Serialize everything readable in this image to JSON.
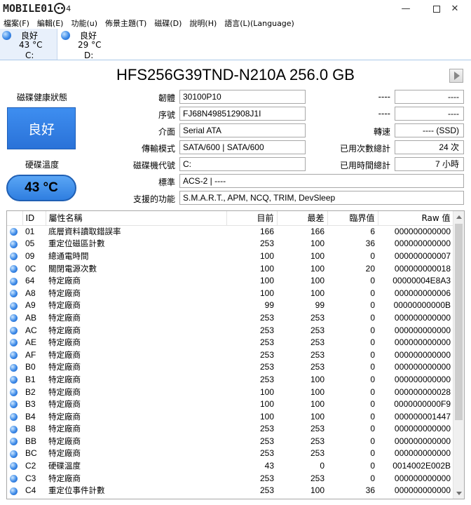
{
  "window": {
    "logo_text": "MOBILE01",
    "logo_version": "4",
    "minimize_label": "—",
    "close_label": "✕"
  },
  "menu": [
    {
      "label": "檔案(F)"
    },
    {
      "label": "編輯(E)"
    },
    {
      "label": "功能(u)"
    },
    {
      "label": "佈景主題(T)"
    },
    {
      "label": "磁碟(D)"
    },
    {
      "label": "說明(H)"
    },
    {
      "label": "語言(L)(Language)"
    }
  ],
  "drives": [
    {
      "status": "良好",
      "temp": "43 °C",
      "letter": "C:",
      "status_color": "#3c8ae8"
    },
    {
      "status": "良好",
      "temp": "29 °C",
      "letter": "D:",
      "status_color": "#3c8ae8"
    }
  ],
  "disk": {
    "title": "HFS256G39TND-N210A 256.0 GB",
    "health_label": "磁碟健康狀態",
    "health_value": "良好",
    "temp_label": "硬碟溫度",
    "temp_value": "43 °C"
  },
  "info_left": {
    "firmware_label": "韌體",
    "firmware": "30100P10",
    "serial_label": "序號",
    "serial": "FJ68N498512908J1I",
    "interface_label": "介面",
    "interface": "Serial ATA",
    "transfer_label": "傳輸模式",
    "transfer": "SATA/600 | SATA/600",
    "drive_letter_label": "磁碟機代號",
    "drive_letter": "C:",
    "standard_label": "標準",
    "standard": "ACS-2 | ----",
    "features_label": "支援的功能",
    "features": "S.M.A.R.T., APM, NCQ, TRIM, DevSleep"
  },
  "info_right": {
    "blank1_label": "----",
    "blank1": "----",
    "blank2_label": "----",
    "blank2": "----",
    "rotation_label": "轉速",
    "rotation": "---- (SSD)",
    "power_count_label": "已用次數總計",
    "power_count": "24 次",
    "power_hours_label": "已用時間總計",
    "power_hours": "7 小時"
  },
  "table": {
    "headers": [
      "",
      "ID",
      "屬性名稱",
      "目前",
      "最差",
      "臨界值",
      "Raw 值"
    ],
    "rows": [
      {
        "id": "01",
        "name": "底層資料讀取錯誤率",
        "current": "166",
        "worst": "166",
        "threshold": "6",
        "raw": "000000000000"
      },
      {
        "id": "05",
        "name": "重定位磁區計數",
        "current": "253",
        "worst": "100",
        "threshold": "36",
        "raw": "000000000000"
      },
      {
        "id": "09",
        "name": "總通電時間",
        "current": "100",
        "worst": "100",
        "threshold": "0",
        "raw": "000000000007"
      },
      {
        "id": "0C",
        "name": "關閉電源次數",
        "current": "100",
        "worst": "100",
        "threshold": "20",
        "raw": "000000000018"
      },
      {
        "id": "64",
        "name": "特定廠商",
        "current": "100",
        "worst": "100",
        "threshold": "0",
        "raw": "00000004E8A3"
      },
      {
        "id": "A8",
        "name": "特定廠商",
        "current": "100",
        "worst": "100",
        "threshold": "0",
        "raw": "000000000006"
      },
      {
        "id": "A9",
        "name": "特定廠商",
        "current": "99",
        "worst": "99",
        "threshold": "0",
        "raw": "00000000000B"
      },
      {
        "id": "AB",
        "name": "特定廠商",
        "current": "253",
        "worst": "253",
        "threshold": "0",
        "raw": "000000000000"
      },
      {
        "id": "AC",
        "name": "特定廠商",
        "current": "253",
        "worst": "253",
        "threshold": "0",
        "raw": "000000000000"
      },
      {
        "id": "AE",
        "name": "特定廠商",
        "current": "253",
        "worst": "253",
        "threshold": "0",
        "raw": "000000000000"
      },
      {
        "id": "AF",
        "name": "特定廠商",
        "current": "253",
        "worst": "253",
        "threshold": "0",
        "raw": "000000000000"
      },
      {
        "id": "B0",
        "name": "特定廠商",
        "current": "253",
        "worst": "253",
        "threshold": "0",
        "raw": "000000000000"
      },
      {
        "id": "B1",
        "name": "特定廠商",
        "current": "253",
        "worst": "100",
        "threshold": "0",
        "raw": "000000000000"
      },
      {
        "id": "B2",
        "name": "特定廠商",
        "current": "100",
        "worst": "100",
        "threshold": "0",
        "raw": "000000000028"
      },
      {
        "id": "B3",
        "name": "特定廠商",
        "current": "100",
        "worst": "100",
        "threshold": "0",
        "raw": "0000000000F9"
      },
      {
        "id": "B4",
        "name": "特定廠商",
        "current": "100",
        "worst": "100",
        "threshold": "0",
        "raw": "000000001447"
      },
      {
        "id": "B8",
        "name": "特定廠商",
        "current": "253",
        "worst": "253",
        "threshold": "0",
        "raw": "000000000000"
      },
      {
        "id": "BB",
        "name": "特定廠商",
        "current": "253",
        "worst": "253",
        "threshold": "0",
        "raw": "000000000000"
      },
      {
        "id": "BC",
        "name": "特定廠商",
        "current": "253",
        "worst": "253",
        "threshold": "0",
        "raw": "000000000000"
      },
      {
        "id": "C2",
        "name": "硬碟溫度",
        "current": "43",
        "worst": "0",
        "threshold": "0",
        "raw": "0014002E002B"
      },
      {
        "id": "C3",
        "name": "特定廠商",
        "current": "253",
        "worst": "253",
        "threshold": "0",
        "raw": "000000000000"
      },
      {
        "id": "C4",
        "name": "重定位事件計數",
        "current": "253",
        "worst": "100",
        "threshold": "36",
        "raw": "000000000000"
      }
    ]
  },
  "colors": {
    "accent": "#3c8ae8",
    "good": "#3c8ae8"
  }
}
